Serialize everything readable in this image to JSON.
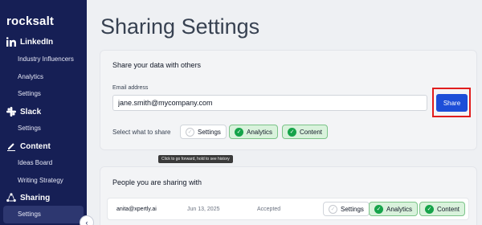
{
  "brand": {
    "logo_text": "rocksalt"
  },
  "sidebar": {
    "sections": [
      {
        "label": "LinkedIn",
        "icon": "linkedin-icon",
        "items": [
          "Industry Influencers",
          "Analytics",
          "Settings"
        ]
      },
      {
        "label": "Slack",
        "icon": "slack-icon",
        "items": [
          "Settings"
        ]
      },
      {
        "label": "Content",
        "icon": "pen-icon",
        "items": [
          "Ideas Board",
          "Writing Strategy"
        ]
      },
      {
        "label": "Sharing",
        "icon": "share-icon",
        "items": [
          "Settings"
        ]
      }
    ],
    "active_item": "Sharing > Settings",
    "collapse_icon": "chevron-left-icon"
  },
  "main": {
    "title": "Sharing Settings",
    "share_card": {
      "title": "Share your data with others",
      "email_label": "Email address",
      "email_value": "jane.smith@mycompany.com",
      "share_button": "Share",
      "select_label": "Select what to share",
      "options": [
        {
          "label": "Settings",
          "checked": false
        },
        {
          "label": "Analytics",
          "checked": true
        },
        {
          "label": "Content",
          "checked": true
        }
      ]
    },
    "tooltip": "Click to go forward, hold to see history",
    "people_card": {
      "title": "People you are sharing with",
      "rows": [
        {
          "email": "anita@xpertly.ai",
          "date": "Jun 13, 2025",
          "status": "Accepted",
          "options": [
            {
              "label": "Settings",
              "checked": false
            },
            {
              "label": "Analytics",
              "checked": true
            },
            {
              "label": "Content",
              "checked": true
            }
          ]
        }
      ]
    }
  },
  "colors": {
    "sidebar_bg": "#161f55",
    "primary_button": "#1d4ed8",
    "highlight_border": "#e11d1d",
    "checked_chip_bg": "#d9f2dc",
    "check_green": "#16a34a"
  }
}
